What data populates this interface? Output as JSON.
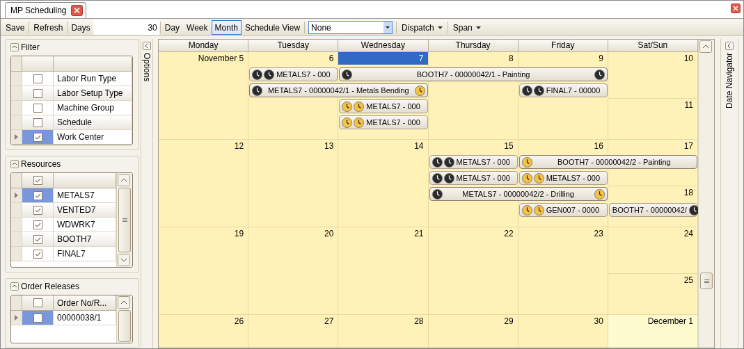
{
  "tab": {
    "title": "MP Scheduling"
  },
  "toolbar": {
    "items": [
      {
        "kind": "button",
        "label": "Save"
      },
      {
        "kind": "button",
        "label": "Refresh"
      },
      {
        "kind": "field",
        "label": "Days",
        "value": "30"
      },
      {
        "kind": "view",
        "label": "Day",
        "selected": false
      },
      {
        "kind": "view",
        "label": "Week",
        "selected": false
      },
      {
        "kind": "view",
        "label": "Month",
        "selected": true
      },
      {
        "kind": "view",
        "label": "Schedule View",
        "selected": false
      },
      {
        "kind": "dropdown",
        "value": "None"
      },
      {
        "kind": "menu",
        "label": "Dispatch"
      },
      {
        "kind": "menu",
        "label": "Span"
      }
    ]
  },
  "left_panel": {
    "panels": [
      {
        "title": "Filter",
        "kind": "plain",
        "rows": [
          {
            "label": "Labor Run Type",
            "checked": false,
            "selected": false
          },
          {
            "label": "Labor Setup Type",
            "checked": false,
            "selected": false
          },
          {
            "label": "Machine Group",
            "checked": false,
            "selected": false
          },
          {
            "label": "Schedule",
            "checked": false,
            "selected": false
          },
          {
            "label": "Work Center",
            "checked": true,
            "selected": true
          }
        ]
      },
      {
        "title": "Resources",
        "kind": "scrolling",
        "header_check": {
          "checked": true
        },
        "rows": [
          {
            "label": "METALS7",
            "checked": true,
            "selected": true
          },
          {
            "label": "VENTED7",
            "checked": true,
            "selected": false
          },
          {
            "label": "WDWRK7",
            "checked": true,
            "selected": false
          },
          {
            "label": "BOOTH7",
            "checked": true,
            "selected": false
          },
          {
            "label": "FINAL7",
            "checked": true,
            "selected": false
          }
        ]
      },
      {
        "title": "Order Releases",
        "kind": "scrolling",
        "header_check": {
          "checked": false
        },
        "column": "Order No/R...",
        "rows": [
          {
            "label": "00000038/1",
            "checked": false,
            "selected": true
          }
        ]
      }
    ]
  },
  "options_strip": {
    "label": "Options"
  },
  "calendar": {
    "columns": [
      "Monday",
      "Tuesday",
      "Wednesday",
      "Thursday",
      "Friday",
      "Sat/Sun"
    ],
    "weeks": [
      {
        "days": [
          {
            "label": "November 5",
            "selected": false,
            "in_month": true
          },
          {
            "label": "6",
            "selected": false,
            "in_month": true
          },
          {
            "label": "7",
            "selected": true,
            "in_month": true
          },
          {
            "label": "8",
            "selected": false,
            "in_month": true
          },
          {
            "label": "9",
            "selected": false,
            "in_month": true
          },
          {
            "label": "10",
            "selected": false,
            "in_month": true
          },
          {
            "label": "11",
            "selected": false,
            "in_month": true
          }
        ],
        "appointments": [
          {
            "text": "METALS7 - 000",
            "icons_start": [
              {
                "color": "#2a2a2a"
              },
              {
                "color": "#2a2a2a"
              }
            ]
          },
          {
            "text": "BOOTH7 - 00000042/1 - Painting",
            "icons_start": [
              {
                "color": "#2a2a2a"
              }
            ],
            "icons_end": [
              {
                "color": "#2a2a2a"
              }
            ]
          },
          {
            "text": "METALS7 - 00000042/1 - Metals Bending",
            "icons_start": [
              {
                "color": "#2a2a2a"
              }
            ],
            "icons_end": [
              {
                "color": "#f7c243"
              }
            ]
          },
          {
            "text": "FINAL7 - 00000",
            "icons_start": [
              {
                "color": "#2a2a2a"
              },
              {
                "color": "#2a2a2a"
              }
            ]
          },
          {
            "text": "METALS7 - 000",
            "icons_start": [
              {
                "color": "#f7c243"
              },
              {
                "color": "#f7c243"
              }
            ]
          },
          {
            "text": "METALS7 - 000",
            "icons_start": [
              {
                "color": "#f7c243"
              },
              {
                "color": "#f7c243"
              }
            ]
          }
        ]
      },
      {
        "days": [
          {
            "label": "12",
            "selected": false,
            "in_month": true
          },
          {
            "label": "13",
            "selected": false,
            "in_month": true
          },
          {
            "label": "14",
            "selected": false,
            "in_month": true
          },
          {
            "label": "15",
            "selected": false,
            "in_month": true
          },
          {
            "label": "16",
            "selected": false,
            "in_month": true
          },
          {
            "label": "17",
            "selected": false,
            "in_month": true
          },
          {
            "label": "18",
            "selected": false,
            "in_month": true
          }
        ],
        "appointments": [
          {
            "text": "METALS7 - 000",
            "icons_start": [
              {
                "color": "#2a2a2a"
              },
              {
                "color": "#2a2a2a"
              }
            ]
          },
          {
            "text": "BOOTH7 - 00000042/2 - Painting",
            "icons_start": [
              {
                "color": "#f7c243"
              }
            ]
          },
          {
            "text": "METALS7 - 000",
            "icons_start": [
              {
                "color": "#2a2a2a"
              },
              {
                "color": "#2a2a2a"
              }
            ]
          },
          {
            "text": "METALS7 - 000",
            "icons_start": [
              {
                "color": "#f7c243"
              },
              {
                "color": "#f7c243"
              }
            ]
          },
          {
            "text": "METALS7 - 00000042/2 - Drilling",
            "icons_start": [
              {
                "color": "#2a2a2a"
              }
            ],
            "icons_end": [
              {
                "color": "#f7c243"
              }
            ]
          },
          {
            "text": "GEN007 - 0000",
            "icons_start": [
              {
                "color": "#f7c243"
              },
              {
                "color": "#f7c243"
              }
            ]
          },
          {
            "text": "BOOTH7 - 00000042/",
            "icons_end": [
              {
                "color": "#2a2a2a"
              }
            ]
          }
        ]
      },
      {
        "days": [
          {
            "label": "19",
            "selected": false,
            "in_month": true
          },
          {
            "label": "20",
            "selected": false,
            "in_month": true
          },
          {
            "label": "21",
            "selected": false,
            "in_month": true
          },
          {
            "label": "22",
            "selected": false,
            "in_month": true
          },
          {
            "label": "23",
            "selected": false,
            "in_month": true
          },
          {
            "label": "24",
            "selected": false,
            "in_month": true
          },
          {
            "label": "25",
            "selected": false,
            "in_month": true
          }
        ]
      },
      {
        "days": [
          {
            "label": "26",
            "selected": false,
            "in_month": true
          },
          {
            "label": "27",
            "selected": false,
            "in_month": true
          },
          {
            "label": "28",
            "selected": false,
            "in_month": true
          },
          {
            "label": "29",
            "selected": false,
            "in_month": true
          },
          {
            "label": "30",
            "selected": false,
            "in_month": true
          },
          {
            "label": "December 1",
            "selected": false,
            "in_month": false
          }
        ]
      }
    ]
  },
  "date_navigator": {
    "label": "Date Navigator"
  }
}
